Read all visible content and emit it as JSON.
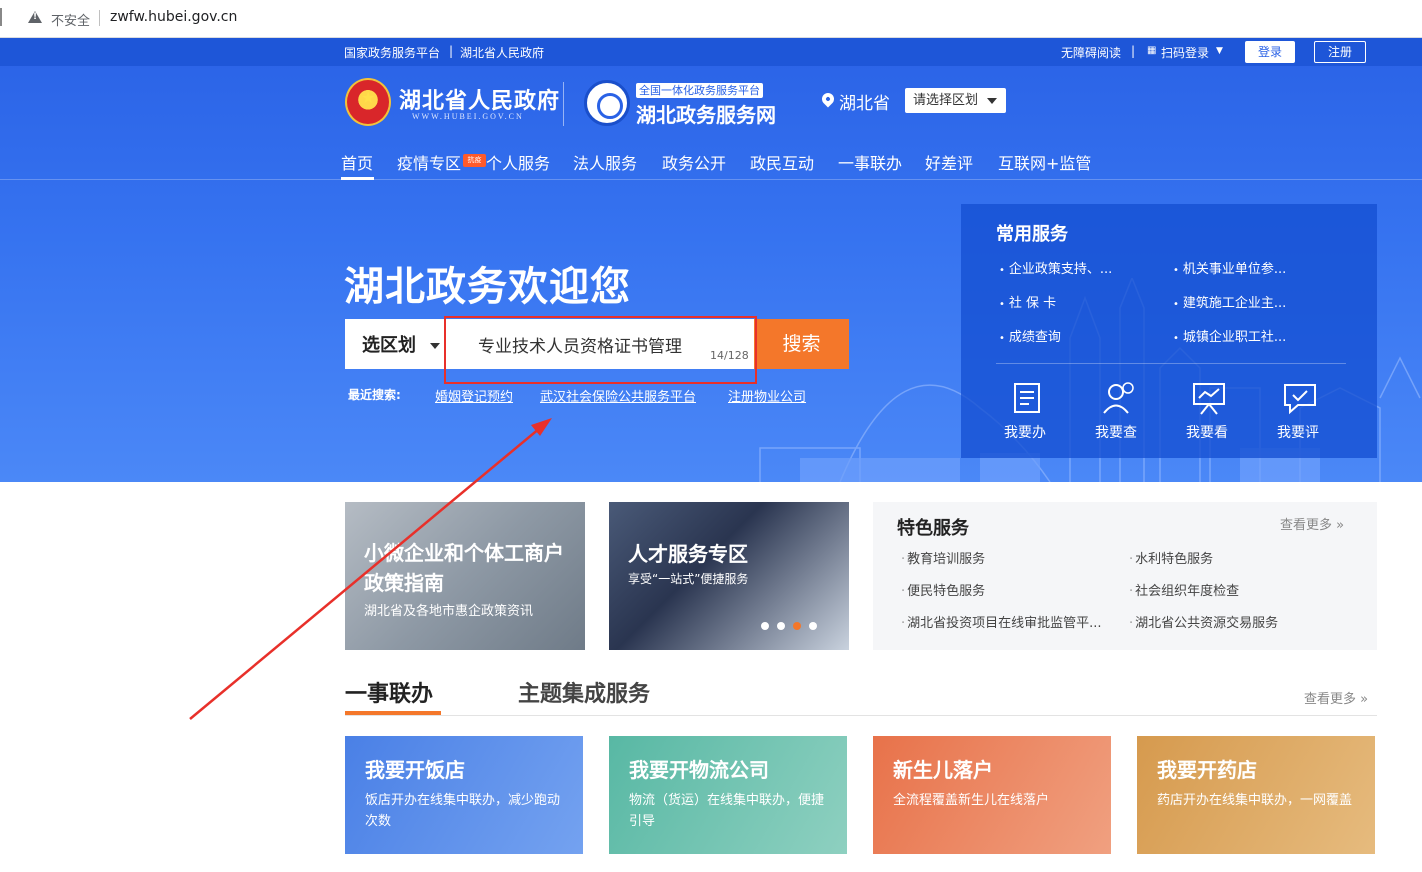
{
  "browser": {
    "insecure_label": "不安全",
    "url": "zwfw.hubei.gov.cn"
  },
  "topbar": {
    "links": [
      "国家政务服务平台",
      "|",
      "湖北省人民政府"
    ],
    "accessibility": "无障碍阅读",
    "scan_login": "扫码登录",
    "login": "登录",
    "register": "注册"
  },
  "header": {
    "gov_name": "湖北省人民政府",
    "gov_domain": "WWW.HUBEI.GOV.CN",
    "platform_tag": "全国一体化政务服务平台",
    "platform_name": "湖北政务服务网",
    "province": "湖北省",
    "region_select": "请选择区划"
  },
  "nav": {
    "items": [
      "首页",
      "疫情专区",
      "个人服务",
      "法人服务",
      "政务公开",
      "政民互动",
      "一事联办",
      "好差评",
      "互联网+监管"
    ],
    "badge": "抗疫"
  },
  "hero": {
    "welcome": "湖北政务欢迎您",
    "region_label": "选区划",
    "search_value": "专业技术人员资格证书管理",
    "counter": "14/128",
    "search_button": "搜索",
    "recent_label": "最近搜索:",
    "recent": [
      "婚姻登记预约",
      "武汉社会保险公共服务平台",
      "注册物业公司"
    ]
  },
  "common_services": {
    "title": "常用服务",
    "links": [
      "企业政策支持、...",
      "机关事业单位参...",
      "社 保 卡",
      "建筑施工企业主...",
      "成绩查询",
      "城镇企业职工社..."
    ],
    "actions": [
      {
        "label": "我要办",
        "icon": "document-icon"
      },
      {
        "label": "我要查",
        "icon": "search-person-icon"
      },
      {
        "label": "我要看",
        "icon": "presentation-icon"
      },
      {
        "label": "我要评",
        "icon": "comment-icon"
      }
    ]
  },
  "cards": {
    "card1": {
      "title": "小微企业和个体工商户政策指南",
      "desc": "湖北省及各地市惠企政策资讯"
    },
    "card2": {
      "title": "人才服务专区",
      "desc": "享受“一站式”便捷服务"
    }
  },
  "featured": {
    "title": "特色服务",
    "more": "查看更多",
    "links": [
      "教育培训服务",
      "水利特色服务",
      "便民特色服务",
      "社会组织年度检查",
      "湖北省投资项目在线审批监管平...",
      "湖北省公共资源交易服务"
    ]
  },
  "tabs": {
    "main": "一事联办",
    "second": "主题集成服务",
    "more": "查看更多"
  },
  "services": [
    {
      "title": "我要开饭店",
      "desc": "饭店开办在线集中联办，减少跑动次数"
    },
    {
      "title": "我要开物流公司",
      "desc": "物流（货运）在线集中联办，便捷引导"
    },
    {
      "title": "新生儿落户",
      "desc": "全流程覆盖新生儿在线落户"
    },
    {
      "title": "我要开药店",
      "desc": "药店开办在线集中联办，一网覆盖"
    }
  ],
  "colors": {
    "primary": "#2a62e6",
    "accent": "#f4772a",
    "annotation_red": "#e8302a"
  }
}
